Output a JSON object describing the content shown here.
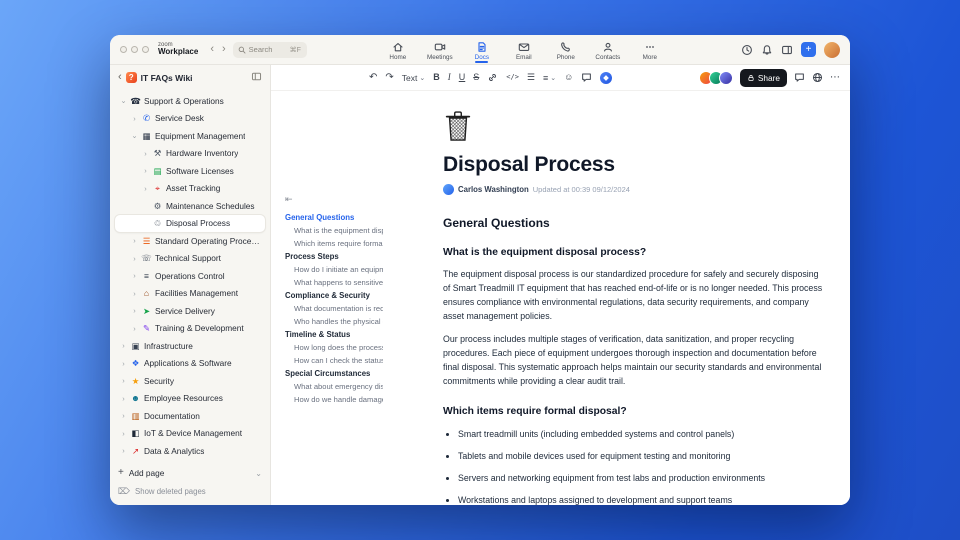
{
  "topbar": {
    "logo_line1": "zoom",
    "logo_line2": "Workplace",
    "search": {
      "placeholder": "Search",
      "shortcut": "⌘F"
    },
    "nav": [
      {
        "label": "Home"
      },
      {
        "label": "Meetings"
      },
      {
        "label": "Docs"
      },
      {
        "label": "Email"
      },
      {
        "label": "Phone"
      },
      {
        "label": "Contacts"
      },
      {
        "label": "More"
      }
    ]
  },
  "sidebar": {
    "title": "IT FAQs Wiki",
    "tree": [
      {
        "label": "Support & Operations",
        "glyph": "☎",
        "color": "#273142",
        "chev": "⌄",
        "depth": 0,
        "icon": "phone-icon"
      },
      {
        "label": "Service Desk",
        "glyph": "✆",
        "color": "#2563eb",
        "chev": "›",
        "depth": 1,
        "icon": "service-desk-icon"
      },
      {
        "label": "Equipment Management",
        "glyph": "▦",
        "color": "#273142",
        "chev": "⌄",
        "depth": 1,
        "icon": "equipment-icon"
      },
      {
        "label": "Hardware Inventory",
        "glyph": "⚒",
        "color": "#4b5563",
        "chev": "›",
        "depth": 2,
        "icon": "hardware-icon"
      },
      {
        "label": "Software Licenses",
        "glyph": "▤",
        "color": "#16a34a",
        "chev": "›",
        "depth": 2,
        "icon": "license-icon"
      },
      {
        "label": "Asset Tracking",
        "glyph": "⌖",
        "color": "#dc2626",
        "chev": "›",
        "depth": 2,
        "icon": "asset-pin-icon"
      },
      {
        "label": "Maintenance Schedules",
        "glyph": "⚙",
        "color": "#4b5563",
        "chev": "",
        "depth": 2,
        "icon": "maintenance-icon"
      },
      {
        "label": "Disposal Process",
        "glyph": "♲",
        "color": "#4b5563",
        "chev": "",
        "depth": 2,
        "selected": true,
        "icon": "trash-icon"
      },
      {
        "label": "Standard Operating Procedures",
        "glyph": "☰",
        "color": "#ea580c",
        "chev": "›",
        "depth": 1,
        "icon": "procedures-icon"
      },
      {
        "label": "Technical Support",
        "glyph": "☏",
        "color": "#4b5563",
        "chev": "›",
        "depth": 1,
        "icon": "tech-support-icon"
      },
      {
        "label": "Operations Control",
        "glyph": "≡",
        "color": "#374151",
        "chev": "›",
        "depth": 1,
        "icon": "operations-icon"
      },
      {
        "label": "Facilities Management",
        "glyph": "⌂",
        "color": "#92400e",
        "chev": "›",
        "depth": 1,
        "icon": "facilities-icon"
      },
      {
        "label": "Service Delivery",
        "glyph": "➤",
        "color": "#16a34a",
        "chev": "›",
        "depth": 1,
        "icon": "delivery-icon"
      },
      {
        "label": "Training & Development",
        "glyph": "✎",
        "color": "#7c3aed",
        "chev": "›",
        "depth": 1,
        "icon": "training-icon"
      },
      {
        "label": "Infrastructure",
        "glyph": "▣",
        "color": "#374151",
        "chev": "›",
        "depth": 0,
        "icon": "infrastructure-icon"
      },
      {
        "label": "Applications & Software",
        "glyph": "❖",
        "color": "#2563eb",
        "chev": "›",
        "depth": 0,
        "icon": "apps-icon"
      },
      {
        "label": "Security",
        "glyph": "★",
        "color": "#f59e0b",
        "chev": "›",
        "depth": 0,
        "icon": "security-icon"
      },
      {
        "label": "Employee Resources",
        "glyph": "☻",
        "color": "#0e7490",
        "chev": "›",
        "depth": 0,
        "icon": "people-icon"
      },
      {
        "label": "Documentation",
        "glyph": "▥",
        "color": "#b45309",
        "chev": "›",
        "depth": 0,
        "icon": "documentation-icon"
      },
      {
        "label": "IoT & Device Management",
        "glyph": "◧",
        "color": "#1f2937",
        "chev": "›",
        "depth": 0,
        "icon": "devices-icon"
      },
      {
        "label": "Data & Analytics",
        "glyph": "↗",
        "color": "#dc2626",
        "chev": "›",
        "depth": 0,
        "icon": "analytics-icon"
      }
    ],
    "add_page_label": "Add page",
    "show_deleted_label": "Show deleted pages"
  },
  "toolbar": {
    "text_style_label": "Text",
    "share_label": "Share"
  },
  "outline": {
    "entries": [
      {
        "text": "General Questions",
        "kind": "section",
        "active": true
      },
      {
        "text": "What is the equipment disp...",
        "kind": "item"
      },
      {
        "text": "Which items require formal ...",
        "kind": "item"
      },
      {
        "text": "Process Steps",
        "kind": "section"
      },
      {
        "text": "How do I initiate an equipm...",
        "kind": "item"
      },
      {
        "text": "What happens to sensitive ...",
        "kind": "item"
      },
      {
        "text": "Compliance & Security",
        "kind": "section"
      },
      {
        "text": "What documentation is req...",
        "kind": "item"
      },
      {
        "text": "Who handles the physical di...",
        "kind": "item"
      },
      {
        "text": "Timeline & Status",
        "kind": "section"
      },
      {
        "text": "How long does the process ...",
        "kind": "item"
      },
      {
        "text": "How can I check the status ...",
        "kind": "item"
      },
      {
        "text": "Special Circumstances",
        "kind": "section"
      },
      {
        "text": "What about emergency dis...",
        "kind": "item"
      },
      {
        "text": "How do we handle damage...",
        "kind": "item"
      }
    ]
  },
  "document": {
    "title": "Disposal Process",
    "author": "Carlos Washington",
    "updated": "Updated at 00:39 09/12/2024",
    "section_heading": "General Questions",
    "q1_heading": "What is the equipment disposal process?",
    "q1_p1": "The equipment disposal process is our standardized procedure for safely and securely disposing of Smart Treadmill IT equipment that has reached end-of-life or is no longer needed. This process ensures compliance with environmental regulations, data security requirements, and company asset management policies.",
    "q1_p2": "Our process includes multiple stages of verification, data sanitization, and proper recycling procedures. Each piece of equipment undergoes thorough inspection and documentation before final disposal. This systematic approach helps maintain our security standards and environmental commitments while providing a clear audit trail.",
    "q2_heading": "Which items require formal disposal?",
    "q2_bullets": [
      "Smart treadmill units (including embedded systems and control panels)",
      "Tablets and mobile devices used for equipment testing and monitoring",
      "Servers and networking equipment from test labs and production environments",
      "Workstations and laptops assigned to development and support teams"
    ]
  },
  "colors": {
    "accent": "#2563eb",
    "share_button": "#15181e"
  }
}
